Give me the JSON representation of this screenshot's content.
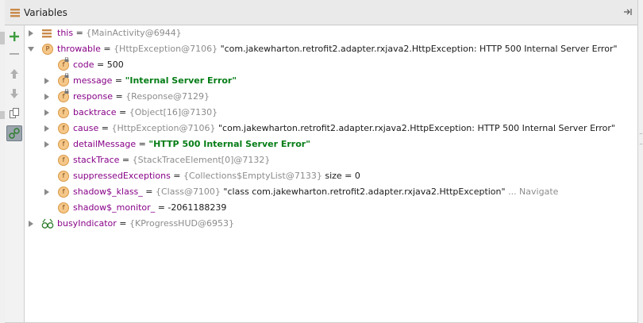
{
  "panel": {
    "title": "Variables"
  },
  "toolbar": {
    "buttons": [
      "add-watch",
      "remove-watch",
      "move-up",
      "move-down",
      "copy",
      "show-types"
    ]
  },
  "rows": [
    {
      "id": "this",
      "name": "this",
      "eq": " = ",
      "ref": "{MainActivity@6944}",
      "value": "",
      "expanded": false,
      "icon": "bars"
    },
    {
      "id": "throwable",
      "name": "throwable",
      "eq": " = ",
      "ref": "{HttpException@7106}",
      "value": " \"com.jakewharton.retrofit2.adapter.rxjava2.HttpException: HTTP 500 Internal Server Error\"",
      "expanded": true,
      "icon": "P"
    },
    {
      "id": "code",
      "name": "code",
      "eq": " = ",
      "ref": "",
      "value": "500",
      "icon": "f-lock"
    },
    {
      "id": "message",
      "name": "message",
      "eq": " = ",
      "ref": "",
      "value": "\"Internal Server Error\"",
      "string": true,
      "icon": "f-lock"
    },
    {
      "id": "response",
      "name": "response",
      "eq": " = ",
      "ref": "{Response@7129}",
      "value": "",
      "icon": "f-lock"
    },
    {
      "id": "backtrace",
      "name": "backtrace",
      "eq": " = ",
      "ref": "{Object[16]@7130}",
      "value": "",
      "icon": "f"
    },
    {
      "id": "cause",
      "name": "cause",
      "eq": " = ",
      "ref": "{HttpException@7106}",
      "value": " \"com.jakewharton.retrofit2.adapter.rxjava2.HttpException: HTTP 500 Internal Server Error\"",
      "icon": "f"
    },
    {
      "id": "detailMessage",
      "name": "detailMessage",
      "eq": " = ",
      "ref": "",
      "value": "\"HTTP 500 Internal Server Error\"",
      "string": true,
      "icon": "f"
    },
    {
      "id": "stackTrace",
      "name": "stackTrace",
      "eq": " = ",
      "ref": "{StackTraceElement[0]@7132}",
      "value": "",
      "icon": "f"
    },
    {
      "id": "suppressedExceptions",
      "name": "suppressedExceptions",
      "eq": " = ",
      "ref": "{Collections$EmptyList@7133}",
      "value": "  size = 0",
      "icon": "f"
    },
    {
      "id": "shadowKlass",
      "name": "shadow$_klass_",
      "eq": " = ",
      "ref": "{Class@7100}",
      "value": " \"class com.jakewharton.retrofit2.adapter.rxjava2.HttpException\"",
      "nav": " ... Navigate",
      "icon": "f"
    },
    {
      "id": "shadowMonitor",
      "name": "shadow$_monitor_",
      "eq": " = ",
      "ref": "",
      "value": "-2061188239",
      "icon": "f"
    },
    {
      "id": "busyIndicator",
      "name": "busyIndicator",
      "eq": " = ",
      "ref": "{KProgressHUD@6953}",
      "value": "",
      "icon": "oo"
    }
  ],
  "colors": {
    "name": "#870387",
    "string": "#067d17",
    "ref": "#8c8c8c",
    "field_icon": "#f5c788"
  }
}
